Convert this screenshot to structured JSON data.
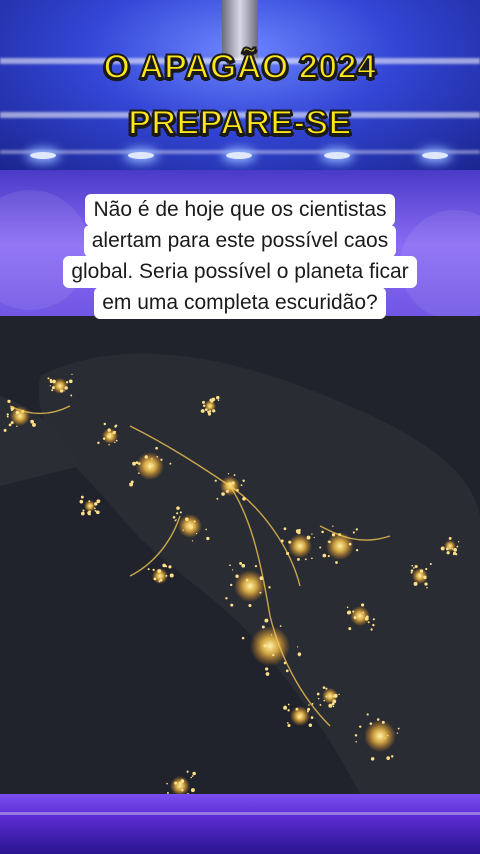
{
  "title": {
    "line1": "O APAGÃO 2024",
    "line2": "PREPARE-SE"
  },
  "caption": {
    "lines": [
      "Não é de hoje que os cientistas",
      "alertam para este possível caos",
      "global. Seria possível o planeta ficar",
      "em uma completa escuridão?"
    ]
  },
  "colors": {
    "title_fill": "#ffe61a",
    "title_stroke": "#1a1a1a",
    "background_blue": "#2f3fd0",
    "background_purple": "#7b5cf0",
    "night_sky": "#22252e",
    "city_lights": "#ffd36a"
  },
  "photo": {
    "subject": "satellite-night-lights"
  }
}
